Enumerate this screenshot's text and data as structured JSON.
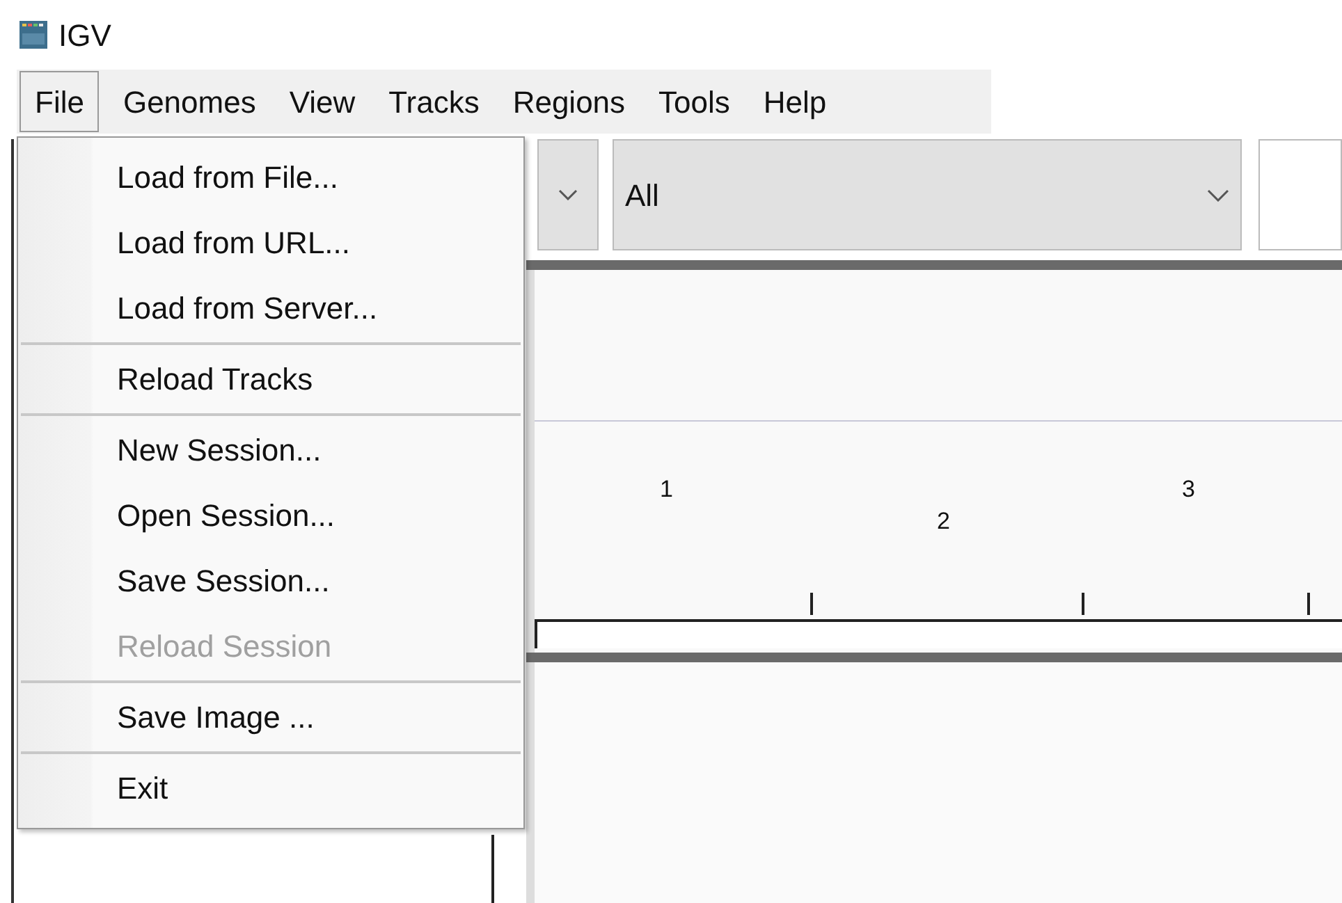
{
  "window": {
    "title": "IGV"
  },
  "menu_bar": [
    {
      "label": "File",
      "selected": true
    },
    {
      "label": "Genomes",
      "selected": false
    },
    {
      "label": "View",
      "selected": false
    },
    {
      "label": "Tracks",
      "selected": false
    },
    {
      "label": "Regions",
      "selected": false
    },
    {
      "label": "Tools",
      "selected": false
    },
    {
      "label": "Help",
      "selected": false
    }
  ],
  "file_menu": [
    {
      "kind": "item",
      "label": "Load from File...",
      "disabled": false
    },
    {
      "kind": "item",
      "label": "Load from URL...",
      "disabled": false
    },
    {
      "kind": "item",
      "label": "Load from Server...",
      "disabled": false
    },
    {
      "kind": "separator"
    },
    {
      "kind": "item",
      "label": "Reload Tracks",
      "disabled": false
    },
    {
      "kind": "separator"
    },
    {
      "kind": "item",
      "label": "New Session...",
      "disabled": false
    },
    {
      "kind": "item",
      "label": "Open Session...",
      "disabled": false
    },
    {
      "kind": "item",
      "label": "Save Session...",
      "disabled": false
    },
    {
      "kind": "item",
      "label": "Reload Session",
      "disabled": true
    },
    {
      "kind": "separator"
    },
    {
      "kind": "item",
      "label": "Save Image ...",
      "disabled": false
    },
    {
      "kind": "separator"
    },
    {
      "kind": "item",
      "label": "Exit",
      "disabled": false
    }
  ],
  "toolbar": {
    "chromosome_dropdown": {
      "value": "All"
    }
  },
  "ruler": {
    "labels": [
      "1",
      "2",
      "3"
    ]
  }
}
